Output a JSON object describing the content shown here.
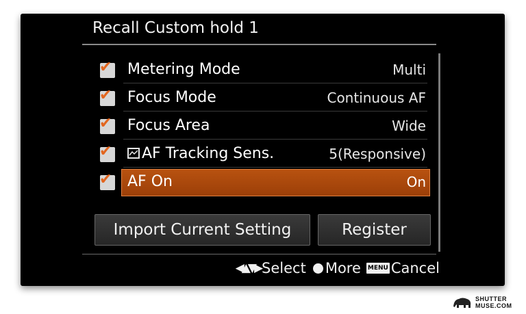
{
  "screen": {
    "title": "Recall Custom hold 1",
    "rows": [
      {
        "label": "Metering Mode",
        "value": "Multi",
        "checked": true,
        "selected": false
      },
      {
        "label": "Focus Mode",
        "value": "Continuous AF",
        "checked": true,
        "selected": false
      },
      {
        "label": "Focus Area",
        "value": "Wide",
        "checked": true,
        "selected": false
      },
      {
        "label": "AF Tracking Sens.",
        "value": "5(Responsive)",
        "checked": true,
        "selected": false,
        "icon": "tracking-sensitivity-icon"
      },
      {
        "label": "AF On",
        "value": "On",
        "checked": true,
        "selected": true
      }
    ],
    "buttons": {
      "import_label": "Import Current Setting",
      "register_label": "Register"
    },
    "footer": {
      "select_label": "Select",
      "more_label": "More",
      "menu_key": "MENU",
      "cancel_label": "Cancel"
    },
    "colors": {
      "accent": "#b85210",
      "checkmark": "#e2651e",
      "background": "#000000"
    }
  },
  "watermark": {
    "line1": "SHUTTER",
    "line2": "MUSE.COM"
  }
}
